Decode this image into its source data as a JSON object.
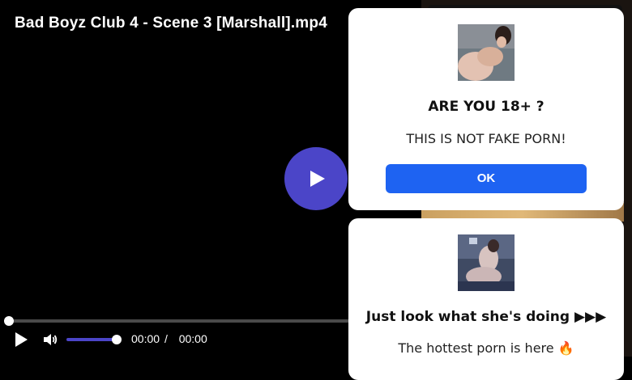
{
  "player": {
    "title": "Bad Boyz Club 4 - Scene 3 [Marshall].mp4",
    "current_time": "00:00",
    "separator": "/",
    "duration": "00:00",
    "progress": 0,
    "volume": 1.0,
    "accent_color": "#4b45c8"
  },
  "popup_age": {
    "heading": "ARE YOU 18+ ?",
    "subtext": "THIS IS NOT FAKE PORN!",
    "ok_label": "OK",
    "button_color": "#1e63f2"
  },
  "popup_ad": {
    "heading": "Just look what she's doing ▶▶▶",
    "subtext": "The hottest porn is here 🔥"
  },
  "icons": {
    "big_play": "play-icon",
    "control_play": "play-icon",
    "volume": "volume-icon"
  }
}
